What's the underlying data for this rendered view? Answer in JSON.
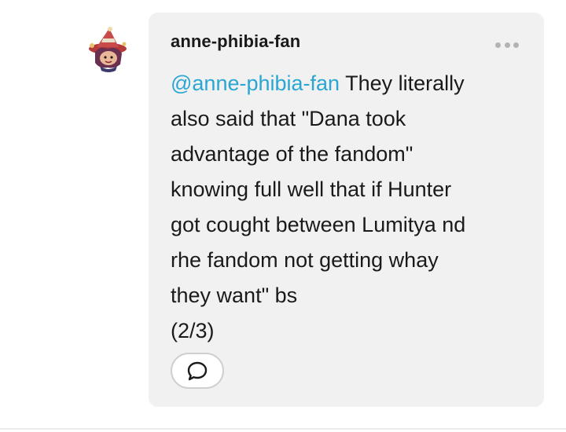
{
  "post": {
    "username": "anne-phibia-fan",
    "mention": "@anne-phibia-fan",
    "text_lines": [
      " They literally",
      "also said that \"Dana took",
      "advantage of the fandom\"",
      "knowing full well that if Hunter",
      "got cought between Lumitya nd",
      "rhe fandom not getting whay",
      "they want\" bs",
      "(2/3)"
    ],
    "avatar_icon": "witch-character-avatar",
    "more_icon": "more-dots-icon",
    "reply_icon": "speech-bubble-icon"
  },
  "colors": {
    "bubble": "#f1f1f1",
    "mention": "#29a6d3",
    "text": "#1a1a1a",
    "dots": "#b3b3b3"
  }
}
